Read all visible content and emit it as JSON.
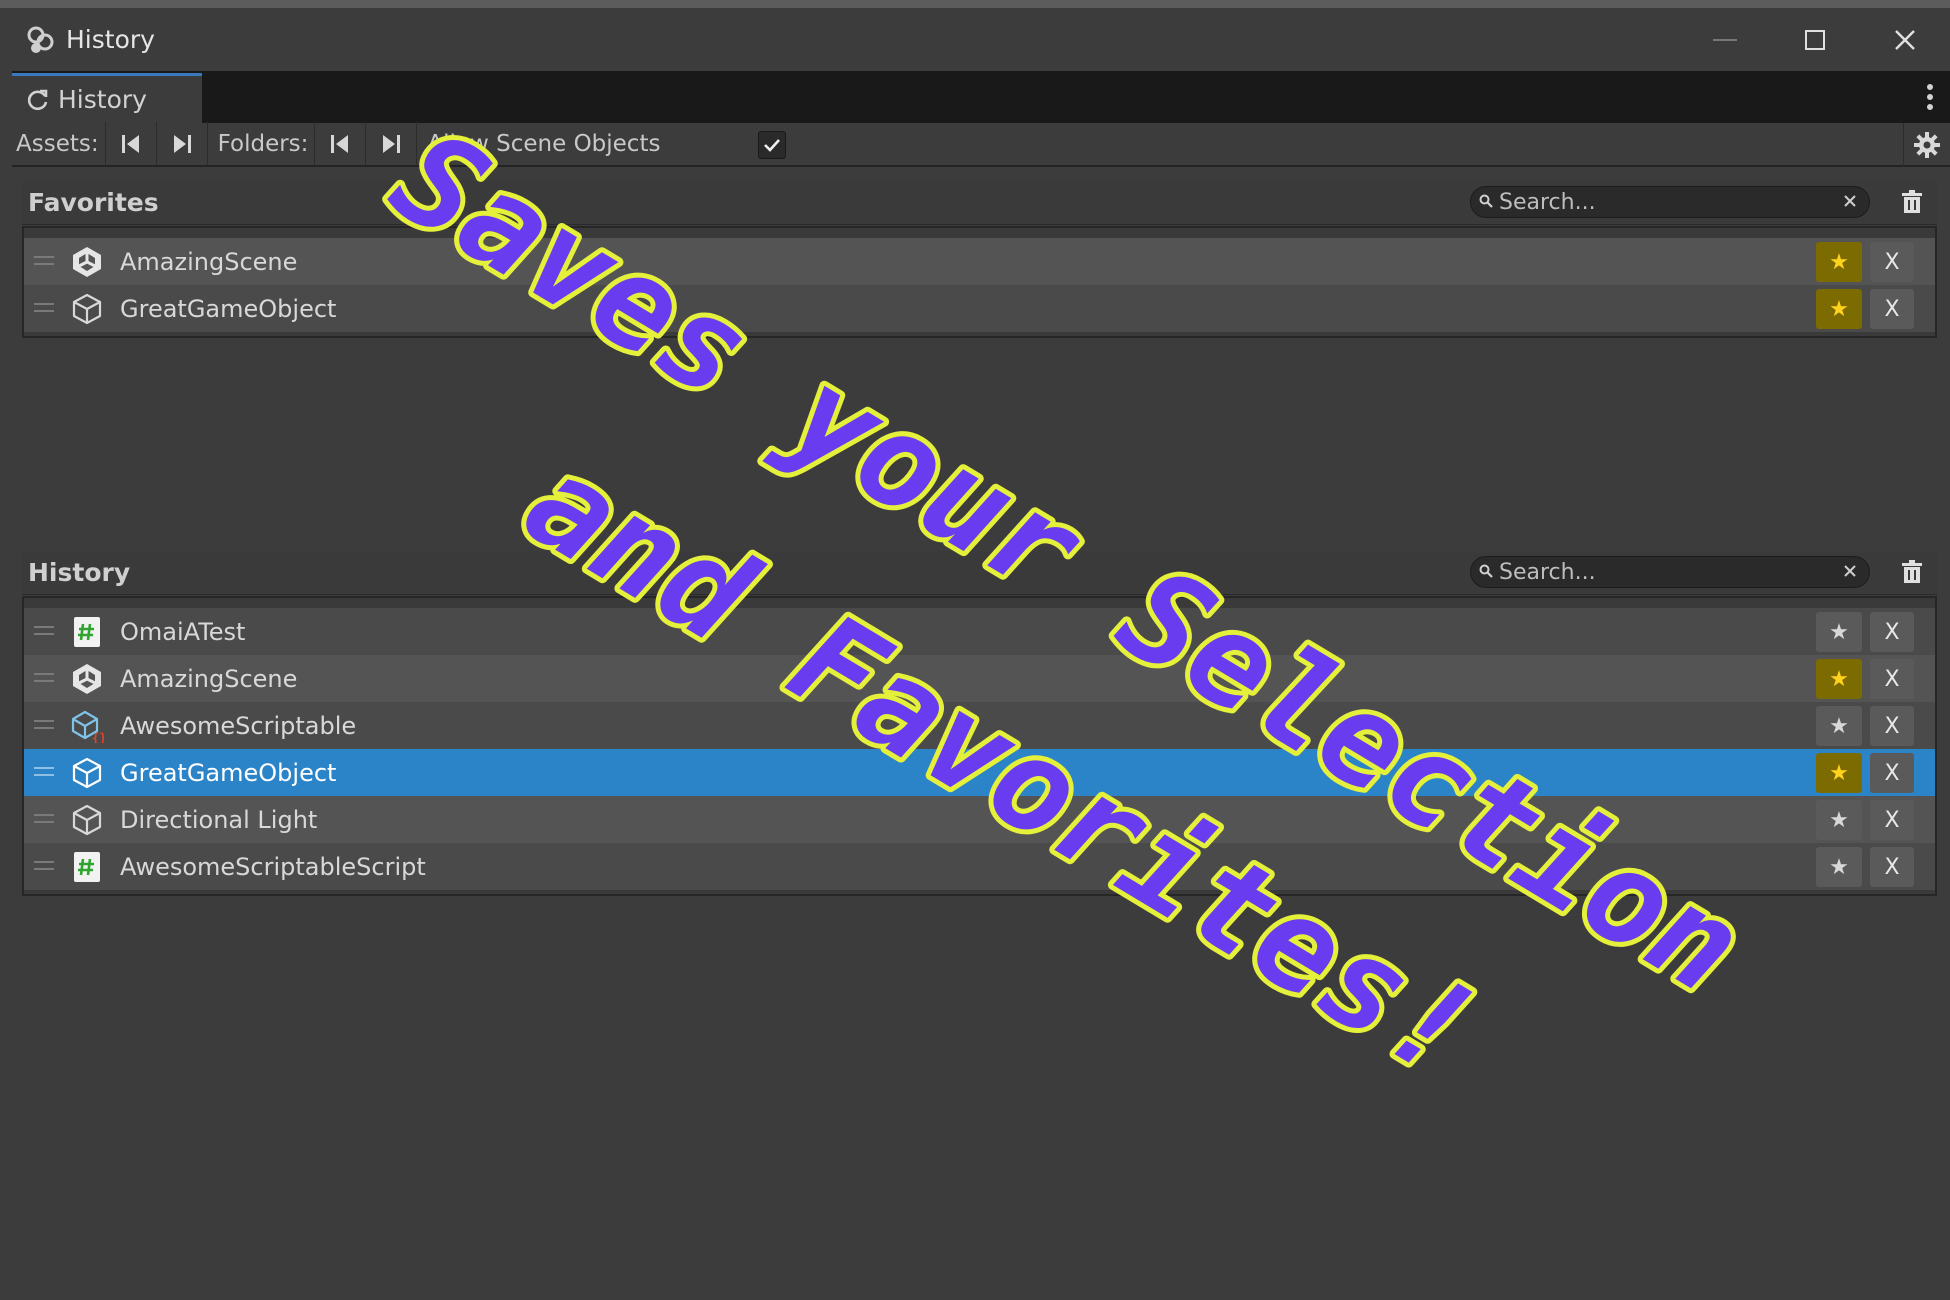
{
  "window": {
    "title": "History"
  },
  "tab": {
    "label": "History"
  },
  "toolbar": {
    "assets_label": "Assets:",
    "folders_label": "Folders:",
    "allow_scene_objects_label": "Allow Scene Objects",
    "allow_scene_objects_checked": true
  },
  "favorites": {
    "title": "Favorites",
    "search_placeholder": "Search...",
    "items": [
      {
        "name": "AmazingScene",
        "icon": "unity-scene-icon",
        "favorited": true
      },
      {
        "name": "GreatGameObject",
        "icon": "gameobject-cube-icon",
        "favorited": true
      }
    ]
  },
  "history": {
    "title": "History",
    "search_placeholder": "Search...",
    "items": [
      {
        "name": "OmaiATest",
        "icon": "csharp-script-icon",
        "favorited": false
      },
      {
        "name": "AmazingScene",
        "icon": "unity-scene-icon",
        "favorited": true
      },
      {
        "name": "AwesomeScriptable",
        "icon": "scriptable-object-icon",
        "favorited": false
      },
      {
        "name": "GreatGameObject",
        "icon": "gameobject-cube-icon",
        "favorited": true,
        "selected": true
      },
      {
        "name": "Directional Light",
        "icon": "gameobject-cube-icon",
        "favorited": false
      },
      {
        "name": "AwesomeScriptableScript",
        "icon": "csharp-script-icon",
        "favorited": false
      }
    ]
  },
  "overlay": {
    "line1": "Saves your Selection",
    "line2": "and Favorites!",
    "fill_color": "#6a3cf0",
    "stroke_color": "#e4f03a"
  },
  "labels": {
    "delete": "X",
    "star": "★"
  }
}
